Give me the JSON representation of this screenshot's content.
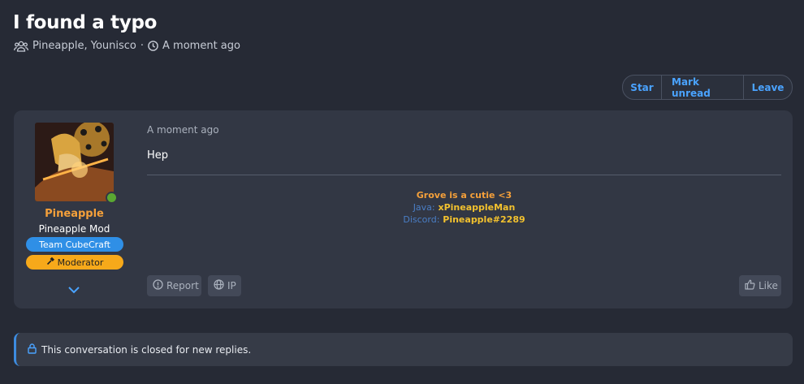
{
  "thread": {
    "title": "I found a typo",
    "participants": "Pineapple, Younisco",
    "separator": "·",
    "time": "A moment ago"
  },
  "actions": {
    "star": "Star",
    "mark_unread": "Mark unread",
    "leave": "Leave"
  },
  "post": {
    "author": {
      "name": "Pineapple",
      "title": "Pineapple Mod",
      "badges": [
        "Team CubeCraft",
        "Moderator"
      ],
      "status": "online"
    },
    "time": "A moment ago",
    "body": "Hep",
    "signature": {
      "line1": "Grove is a cutie <3",
      "java_label": "Java:",
      "java_value": "xPineappleMan",
      "discord_label": "Discord:",
      "discord_value": "Pineapple#2289"
    },
    "buttons": {
      "report": "Report",
      "ip": "IP",
      "like": "Like"
    }
  },
  "notice": {
    "text": "This conversation is closed for new replies."
  },
  "colors": {
    "background": "#262a35",
    "card": "#323744",
    "accent_blue": "#4aa3ff",
    "username_orange": "#f5a03a",
    "team_badge": "#2f8fe6",
    "moderator_badge": "#f7a91a",
    "online_green": "#5aa832"
  },
  "icons": [
    "users-icon",
    "clock-icon",
    "online-status-icon",
    "hammer-icon",
    "chevron-down-icon",
    "info-circle-icon",
    "globe-icon",
    "thumbs-up-icon",
    "lock-icon"
  ]
}
